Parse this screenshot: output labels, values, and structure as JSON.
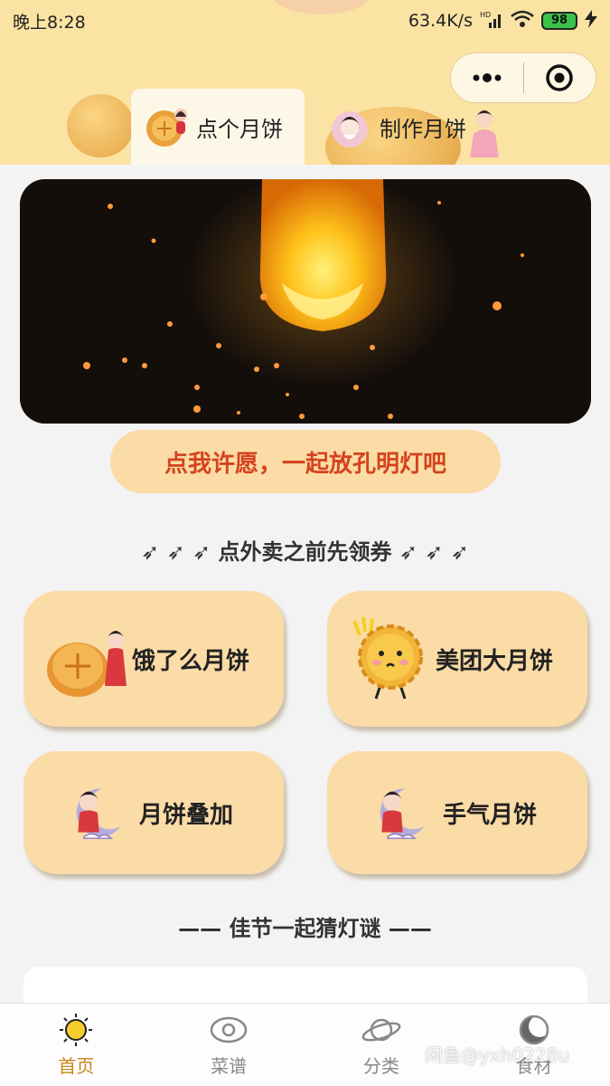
{
  "status_bar": {
    "time": "晚上8:28",
    "network_speed": "63.4K/s",
    "network_type": "HD",
    "battery": "98"
  },
  "capsule": {
    "more_icon": "more-dots-icon",
    "close_icon": "target-circle-icon"
  },
  "tabs": [
    {
      "label": "点个月饼",
      "icon": "mooncake-icon",
      "active": true
    },
    {
      "label": "制作月饼",
      "icon": "chang-e-icon",
      "active": false
    }
  ],
  "banner": {
    "description_icon": "sky-lantern-image"
  },
  "wish_button": {
    "label": "点我许愿，一起放孔明灯吧"
  },
  "coupon_section": {
    "title": "➶ ➶ ➶ 点外卖之前先领券 ➶ ➶ ➶"
  },
  "coupons": [
    {
      "label": "饿了么月饼",
      "icon": "mooncake-chang-e-icon"
    },
    {
      "label": "美团大月饼",
      "icon": "cartoon-mooncake-icon"
    },
    {
      "label": "月饼叠加",
      "icon": "chang-e-moon-icon"
    },
    {
      "label": "手气月饼",
      "icon": "chang-e-moon-icon"
    }
  ],
  "riddle_section": {
    "title": "—— 佳节一起猜灯谜 ——"
  },
  "bottom_nav": [
    {
      "label": "首页",
      "icon": "sun-icon",
      "active": true
    },
    {
      "label": "菜谱",
      "icon": "eye-icon",
      "active": false
    },
    {
      "label": "分类",
      "icon": "planet-icon",
      "active": false
    },
    {
      "label": "食材",
      "icon": "moon-icon",
      "active": false
    }
  ],
  "watermark": "闲鱼@yxh0228u",
  "colors": {
    "header_bg": "#fbe3a3",
    "card_bg": "#fbdca7",
    "wish_text": "#d5431e",
    "nav_active": "#c6861a"
  }
}
